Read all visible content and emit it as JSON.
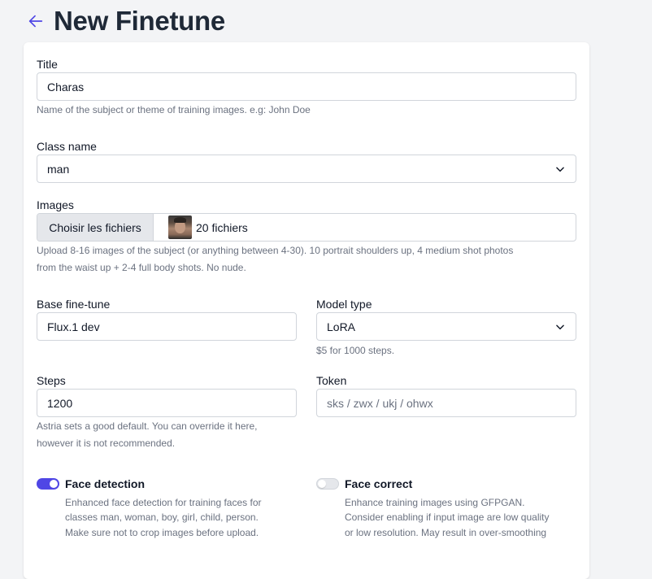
{
  "page": {
    "title": "New Finetune"
  },
  "form": {
    "title": {
      "label": "Title",
      "value": "Charas",
      "help": "Name of the subject or theme of training images. e.g: John Doe"
    },
    "class_name": {
      "label": "Class name",
      "value": "man"
    },
    "images": {
      "label": "Images",
      "button_label": "Choisir les fichiers",
      "file_count": "20 fichiers",
      "help_line1": "Upload 8-16 images of the subject (or anything between 4-30). 10 portrait shoulders up, 4 medium shot photos",
      "help_line2": "from the waist up + 2-4 full body shots. No nude."
    },
    "base_finetune": {
      "label": "Base fine-tune",
      "value": "Flux.1 dev"
    },
    "model_type": {
      "label": "Model type",
      "value": "LoRA",
      "help": "$5 for 1000 steps."
    },
    "steps": {
      "label": "Steps",
      "value": "1200",
      "help_line1": "Astria sets a good default. You can override it here,",
      "help_line2": "however it is not recommended."
    },
    "token": {
      "label": "Token",
      "value": "",
      "placeholder": "sks / zwx / ukj / ohwx"
    },
    "face_detection": {
      "label": "Face detection",
      "enabled": true,
      "help_line1": "Enhanced face detection for training faces for",
      "help_line2": "classes man, woman, boy, girl, child, person.",
      "help_line3": "Make sure not to crop images before upload."
    },
    "face_correct": {
      "label": "Face correct",
      "enabled": false,
      "help_line1": "Enhance training images using GFPGAN.",
      "help_line2": "Consider enabling if input image are low quality",
      "help_line3": "or low resolution. May result in over-smoothing"
    }
  },
  "icons": {
    "back": "arrow-left-icon",
    "dropdown": "chevron-down-icon"
  },
  "colors": {
    "accent": "#4f46e5",
    "background": "#f3f4f6",
    "text": "#111827",
    "muted": "#6b7280"
  }
}
